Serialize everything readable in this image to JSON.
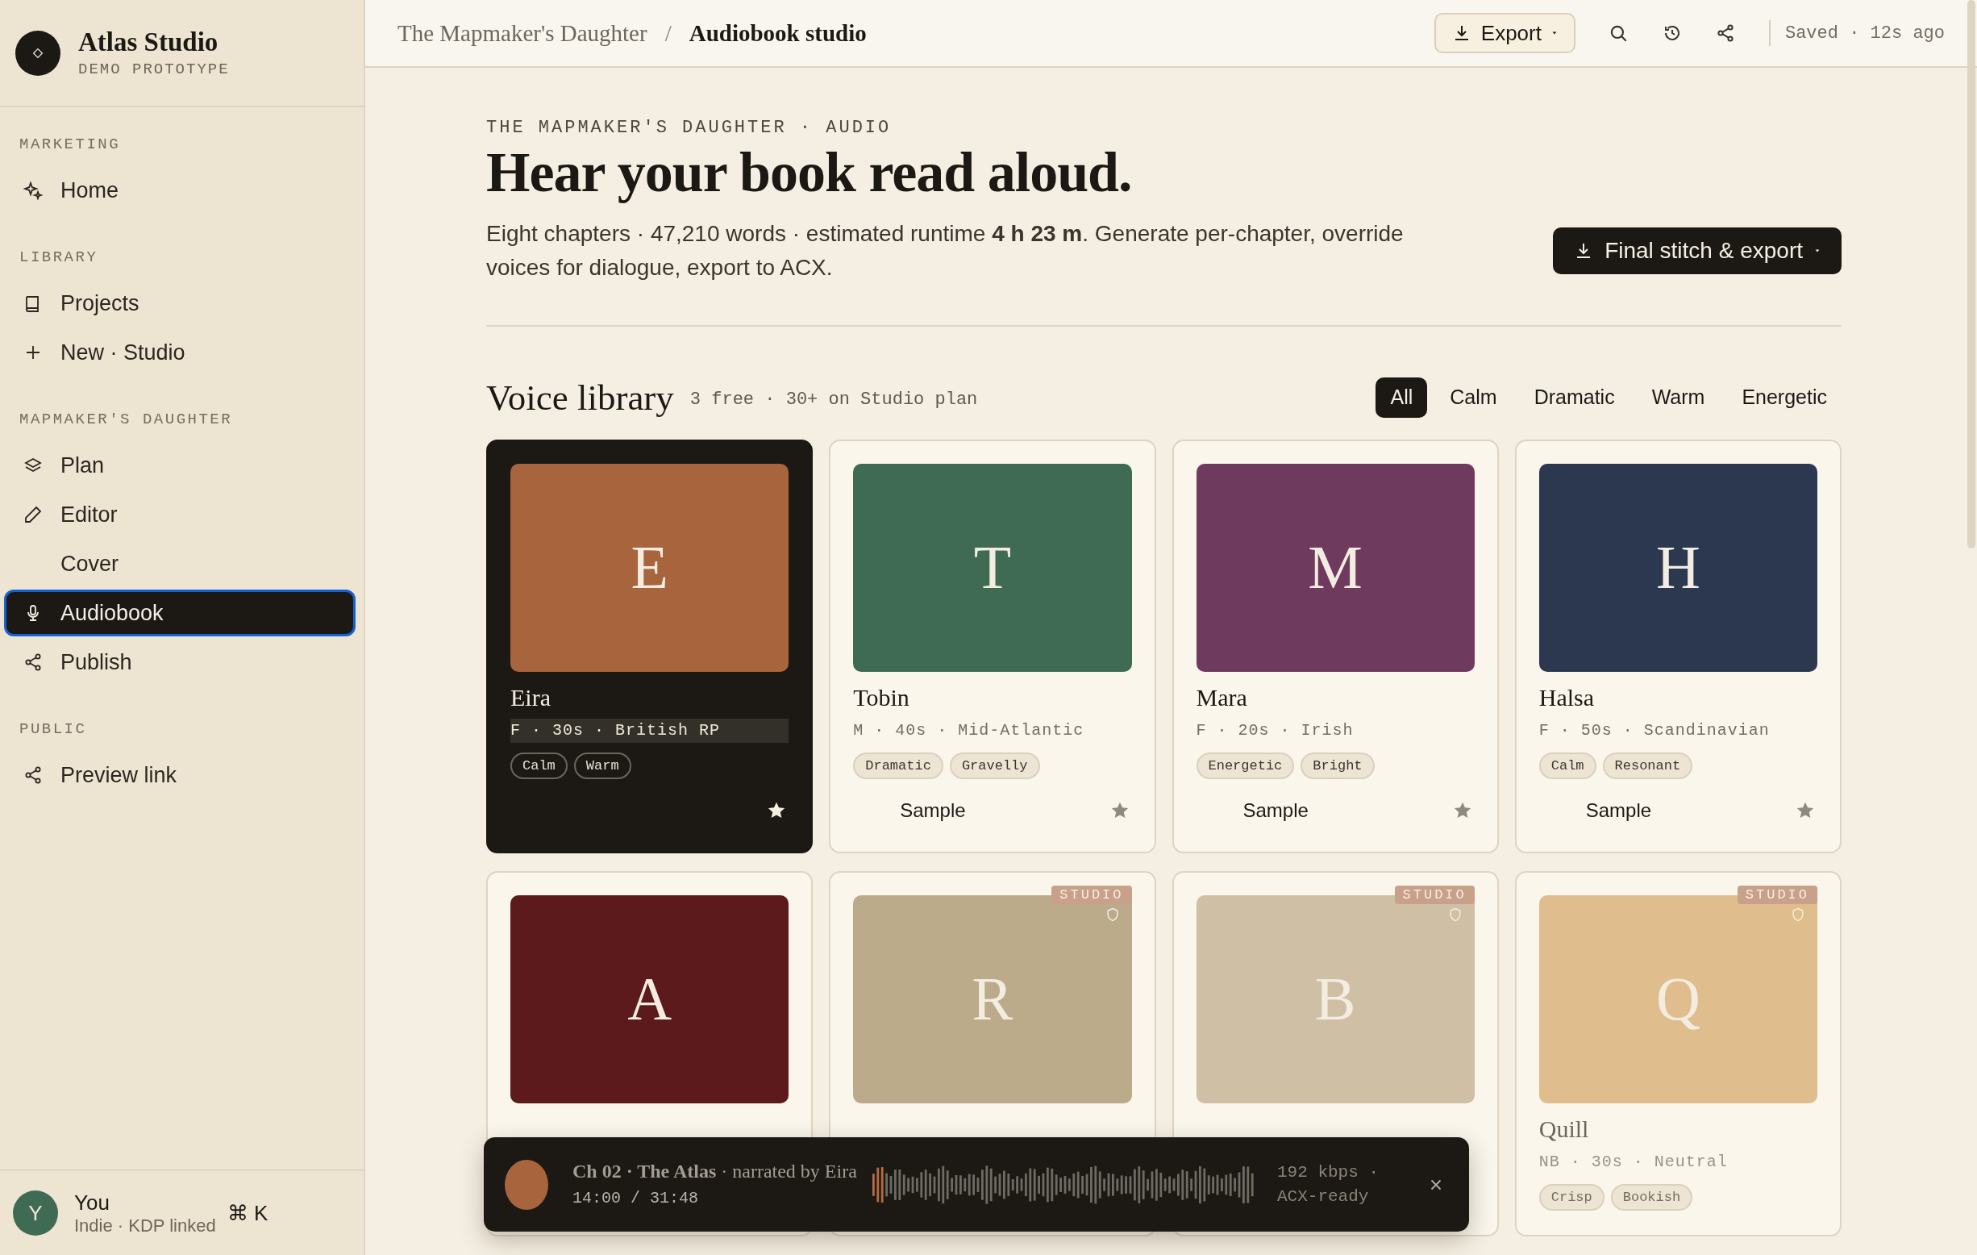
{
  "sidebar": {
    "brand": {
      "title": "Atlas Studio",
      "subtitle": "DEMO PROTOTYPE"
    },
    "sections": [
      {
        "label": "MARKETING",
        "items": [
          {
            "label": "Home",
            "kind": "sparkle",
            "selected": false
          }
        ]
      },
      {
        "label": "LIBRARY",
        "items": [
          {
            "label": "Projects",
            "kind": "book",
            "selected": false
          },
          {
            "label": "New · Studio",
            "kind": "plus",
            "selected": false
          }
        ]
      },
      {
        "label": "MAPMAKER'S DAUGHTER",
        "items": [
          {
            "label": "Plan",
            "kind": "layers",
            "selected": false
          },
          {
            "label": "Editor",
            "kind": "pencil",
            "selected": false
          },
          {
            "label": "Cover",
            "selected": false
          },
          {
            "label": "Audiobook",
            "kind": "mic",
            "selected": true
          },
          {
            "label": "Publish",
            "kind": "share",
            "selected": false
          }
        ]
      },
      {
        "label": "PUBLIC",
        "items": [
          {
            "label": "Preview link",
            "kind": "share",
            "selected": false
          }
        ]
      }
    ],
    "user": {
      "initial": "Y",
      "name": "You",
      "detail": "Indie · KDP linked",
      "shortcut": "⌘ K"
    }
  },
  "header": {
    "breadcrumb": [
      {
        "label": "The Mapmaker's Daughter",
        "current": false
      },
      {
        "label": "Audiobook studio",
        "current": true
      }
    ],
    "separator": "/",
    "export_button": "Export",
    "saved": "Saved · 12s ago"
  },
  "hero": {
    "eyebrow": "THE MAPMAKER'S DAUGHTER · AUDIO",
    "title": "Hear your book read aloud.",
    "description": "Eight chapters · 47,210 words · estimated runtime **4 h 23 m**. Generate per-chapter, override voices for dialogue, export to ACX.",
    "button": "Final stitch & export"
  },
  "library": {
    "title": "Voice library",
    "note": "3 free · 30+ on Studio plan",
    "filters": [
      {
        "label": "All",
        "selected": true
      },
      {
        "label": "Calm",
        "selected": false
      },
      {
        "label": "Dramatic",
        "selected": false
      },
      {
        "label": "Warm",
        "selected": false
      },
      {
        "label": "Energetic",
        "selected": false
      }
    ],
    "voices": [
      {
        "initial": "E",
        "color": "#a8643c",
        "name": "Eira",
        "meta": "F · 30s · British RP",
        "tags": [
          "Calm",
          "Warm"
        ],
        "selected": true,
        "footer": true
      },
      {
        "initial": "T",
        "color": "#3f6b55",
        "name": "Tobin",
        "meta": "M · 40s · Mid-Atlantic",
        "tags": [
          "Dramatic",
          "Gravelly"
        ],
        "sample": "Sample",
        "selected": false,
        "footer": true
      },
      {
        "initial": "M",
        "color": "#6e3a5e",
        "name": "Mara",
        "meta": "F · 20s · Irish",
        "tags": [
          "Energetic",
          "Bright"
        ],
        "sample": "Sample",
        "selected": false,
        "footer": true
      },
      {
        "initial": "H",
        "color": "#2c3850",
        "name": "Halsa",
        "meta": "F · 50s · Scandinavian",
        "tags": [
          "Calm",
          "Resonant"
        ],
        "sample": "Sample",
        "selected": false,
        "footer": true
      },
      {
        "initial": "A",
        "color": "#5c1a1c",
        "selected": false,
        "footer": false
      },
      {
        "initial": "R",
        "color": "#bcab8b",
        "badge": "STUDIO",
        "selected": false,
        "footer": false
      },
      {
        "initial": "B",
        "color": "#cfbfa5",
        "badge": "STUDIO",
        "selected": false,
        "footer": false
      },
      {
        "initial": "Q",
        "color": "#dfbd8c",
        "badge": "STUDIO",
        "name": "Quill",
        "meta": "NB · 30s · Neutral",
        "tags": [
          "Crisp",
          "Bookish"
        ],
        "selected": false,
        "footer": false
      }
    ]
  },
  "player": {
    "title": "**Ch 02 · The Atlas** · narrated by Eira",
    "time": "14:00 / 31:48",
    "quality": "192 kbps · ACX-ready"
  }
}
